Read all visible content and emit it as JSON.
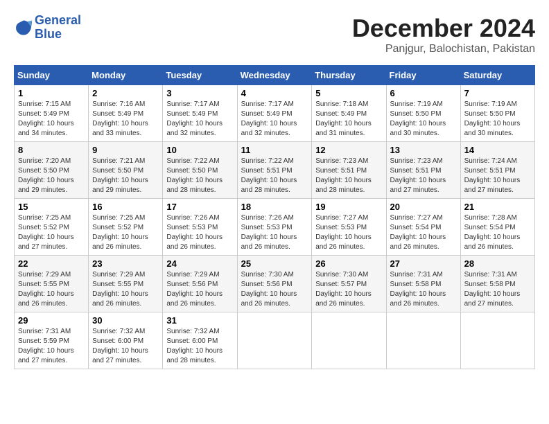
{
  "app": {
    "logo_line1": "General",
    "logo_line2": "Blue"
  },
  "header": {
    "month": "December 2024",
    "location": "Panjgur, Balochistan, Pakistan"
  },
  "weekdays": [
    "Sunday",
    "Monday",
    "Tuesday",
    "Wednesday",
    "Thursday",
    "Friday",
    "Saturday"
  ],
  "weeks": [
    [
      {
        "day": "1",
        "sunrise": "Sunrise: 7:15 AM",
        "sunset": "Sunset: 5:49 PM",
        "daylight": "Daylight: 10 hours and 34 minutes."
      },
      {
        "day": "2",
        "sunrise": "Sunrise: 7:16 AM",
        "sunset": "Sunset: 5:49 PM",
        "daylight": "Daylight: 10 hours and 33 minutes."
      },
      {
        "day": "3",
        "sunrise": "Sunrise: 7:17 AM",
        "sunset": "Sunset: 5:49 PM",
        "daylight": "Daylight: 10 hours and 32 minutes."
      },
      {
        "day": "4",
        "sunrise": "Sunrise: 7:17 AM",
        "sunset": "Sunset: 5:49 PM",
        "daylight": "Daylight: 10 hours and 32 minutes."
      },
      {
        "day": "5",
        "sunrise": "Sunrise: 7:18 AM",
        "sunset": "Sunset: 5:49 PM",
        "daylight": "Daylight: 10 hours and 31 minutes."
      },
      {
        "day": "6",
        "sunrise": "Sunrise: 7:19 AM",
        "sunset": "Sunset: 5:50 PM",
        "daylight": "Daylight: 10 hours and 30 minutes."
      },
      {
        "day": "7",
        "sunrise": "Sunrise: 7:19 AM",
        "sunset": "Sunset: 5:50 PM",
        "daylight": "Daylight: 10 hours and 30 minutes."
      }
    ],
    [
      {
        "day": "8",
        "sunrise": "Sunrise: 7:20 AM",
        "sunset": "Sunset: 5:50 PM",
        "daylight": "Daylight: 10 hours and 29 minutes."
      },
      {
        "day": "9",
        "sunrise": "Sunrise: 7:21 AM",
        "sunset": "Sunset: 5:50 PM",
        "daylight": "Daylight: 10 hours and 29 minutes."
      },
      {
        "day": "10",
        "sunrise": "Sunrise: 7:22 AM",
        "sunset": "Sunset: 5:50 PM",
        "daylight": "Daylight: 10 hours and 28 minutes."
      },
      {
        "day": "11",
        "sunrise": "Sunrise: 7:22 AM",
        "sunset": "Sunset: 5:51 PM",
        "daylight": "Daylight: 10 hours and 28 minutes."
      },
      {
        "day": "12",
        "sunrise": "Sunrise: 7:23 AM",
        "sunset": "Sunset: 5:51 PM",
        "daylight": "Daylight: 10 hours and 28 minutes."
      },
      {
        "day": "13",
        "sunrise": "Sunrise: 7:23 AM",
        "sunset": "Sunset: 5:51 PM",
        "daylight": "Daylight: 10 hours and 27 minutes."
      },
      {
        "day": "14",
        "sunrise": "Sunrise: 7:24 AM",
        "sunset": "Sunset: 5:51 PM",
        "daylight": "Daylight: 10 hours and 27 minutes."
      }
    ],
    [
      {
        "day": "15",
        "sunrise": "Sunrise: 7:25 AM",
        "sunset": "Sunset: 5:52 PM",
        "daylight": "Daylight: 10 hours and 27 minutes."
      },
      {
        "day": "16",
        "sunrise": "Sunrise: 7:25 AM",
        "sunset": "Sunset: 5:52 PM",
        "daylight": "Daylight: 10 hours and 26 minutes."
      },
      {
        "day": "17",
        "sunrise": "Sunrise: 7:26 AM",
        "sunset": "Sunset: 5:53 PM",
        "daylight": "Daylight: 10 hours and 26 minutes."
      },
      {
        "day": "18",
        "sunrise": "Sunrise: 7:26 AM",
        "sunset": "Sunset: 5:53 PM",
        "daylight": "Daylight: 10 hours and 26 minutes."
      },
      {
        "day": "19",
        "sunrise": "Sunrise: 7:27 AM",
        "sunset": "Sunset: 5:53 PM",
        "daylight": "Daylight: 10 hours and 26 minutes."
      },
      {
        "day": "20",
        "sunrise": "Sunrise: 7:27 AM",
        "sunset": "Sunset: 5:54 PM",
        "daylight": "Daylight: 10 hours and 26 minutes."
      },
      {
        "day": "21",
        "sunrise": "Sunrise: 7:28 AM",
        "sunset": "Sunset: 5:54 PM",
        "daylight": "Daylight: 10 hours and 26 minutes."
      }
    ],
    [
      {
        "day": "22",
        "sunrise": "Sunrise: 7:29 AM",
        "sunset": "Sunset: 5:55 PM",
        "daylight": "Daylight: 10 hours and 26 minutes."
      },
      {
        "day": "23",
        "sunrise": "Sunrise: 7:29 AM",
        "sunset": "Sunset: 5:55 PM",
        "daylight": "Daylight: 10 hours and 26 minutes."
      },
      {
        "day": "24",
        "sunrise": "Sunrise: 7:29 AM",
        "sunset": "Sunset: 5:56 PM",
        "daylight": "Daylight: 10 hours and 26 minutes."
      },
      {
        "day": "25",
        "sunrise": "Sunrise: 7:30 AM",
        "sunset": "Sunset: 5:56 PM",
        "daylight": "Daylight: 10 hours and 26 minutes."
      },
      {
        "day": "26",
        "sunrise": "Sunrise: 7:30 AM",
        "sunset": "Sunset: 5:57 PM",
        "daylight": "Daylight: 10 hours and 26 minutes."
      },
      {
        "day": "27",
        "sunrise": "Sunrise: 7:31 AM",
        "sunset": "Sunset: 5:58 PM",
        "daylight": "Daylight: 10 hours and 26 minutes."
      },
      {
        "day": "28",
        "sunrise": "Sunrise: 7:31 AM",
        "sunset": "Sunset: 5:58 PM",
        "daylight": "Daylight: 10 hours and 27 minutes."
      }
    ],
    [
      {
        "day": "29",
        "sunrise": "Sunrise: 7:31 AM",
        "sunset": "Sunset: 5:59 PM",
        "daylight": "Daylight: 10 hours and 27 minutes."
      },
      {
        "day": "30",
        "sunrise": "Sunrise: 7:32 AM",
        "sunset": "Sunset: 6:00 PM",
        "daylight": "Daylight: 10 hours and 27 minutes."
      },
      {
        "day": "31",
        "sunrise": "Sunrise: 7:32 AM",
        "sunset": "Sunset: 6:00 PM",
        "daylight": "Daylight: 10 hours and 28 minutes."
      },
      null,
      null,
      null,
      null
    ]
  ]
}
